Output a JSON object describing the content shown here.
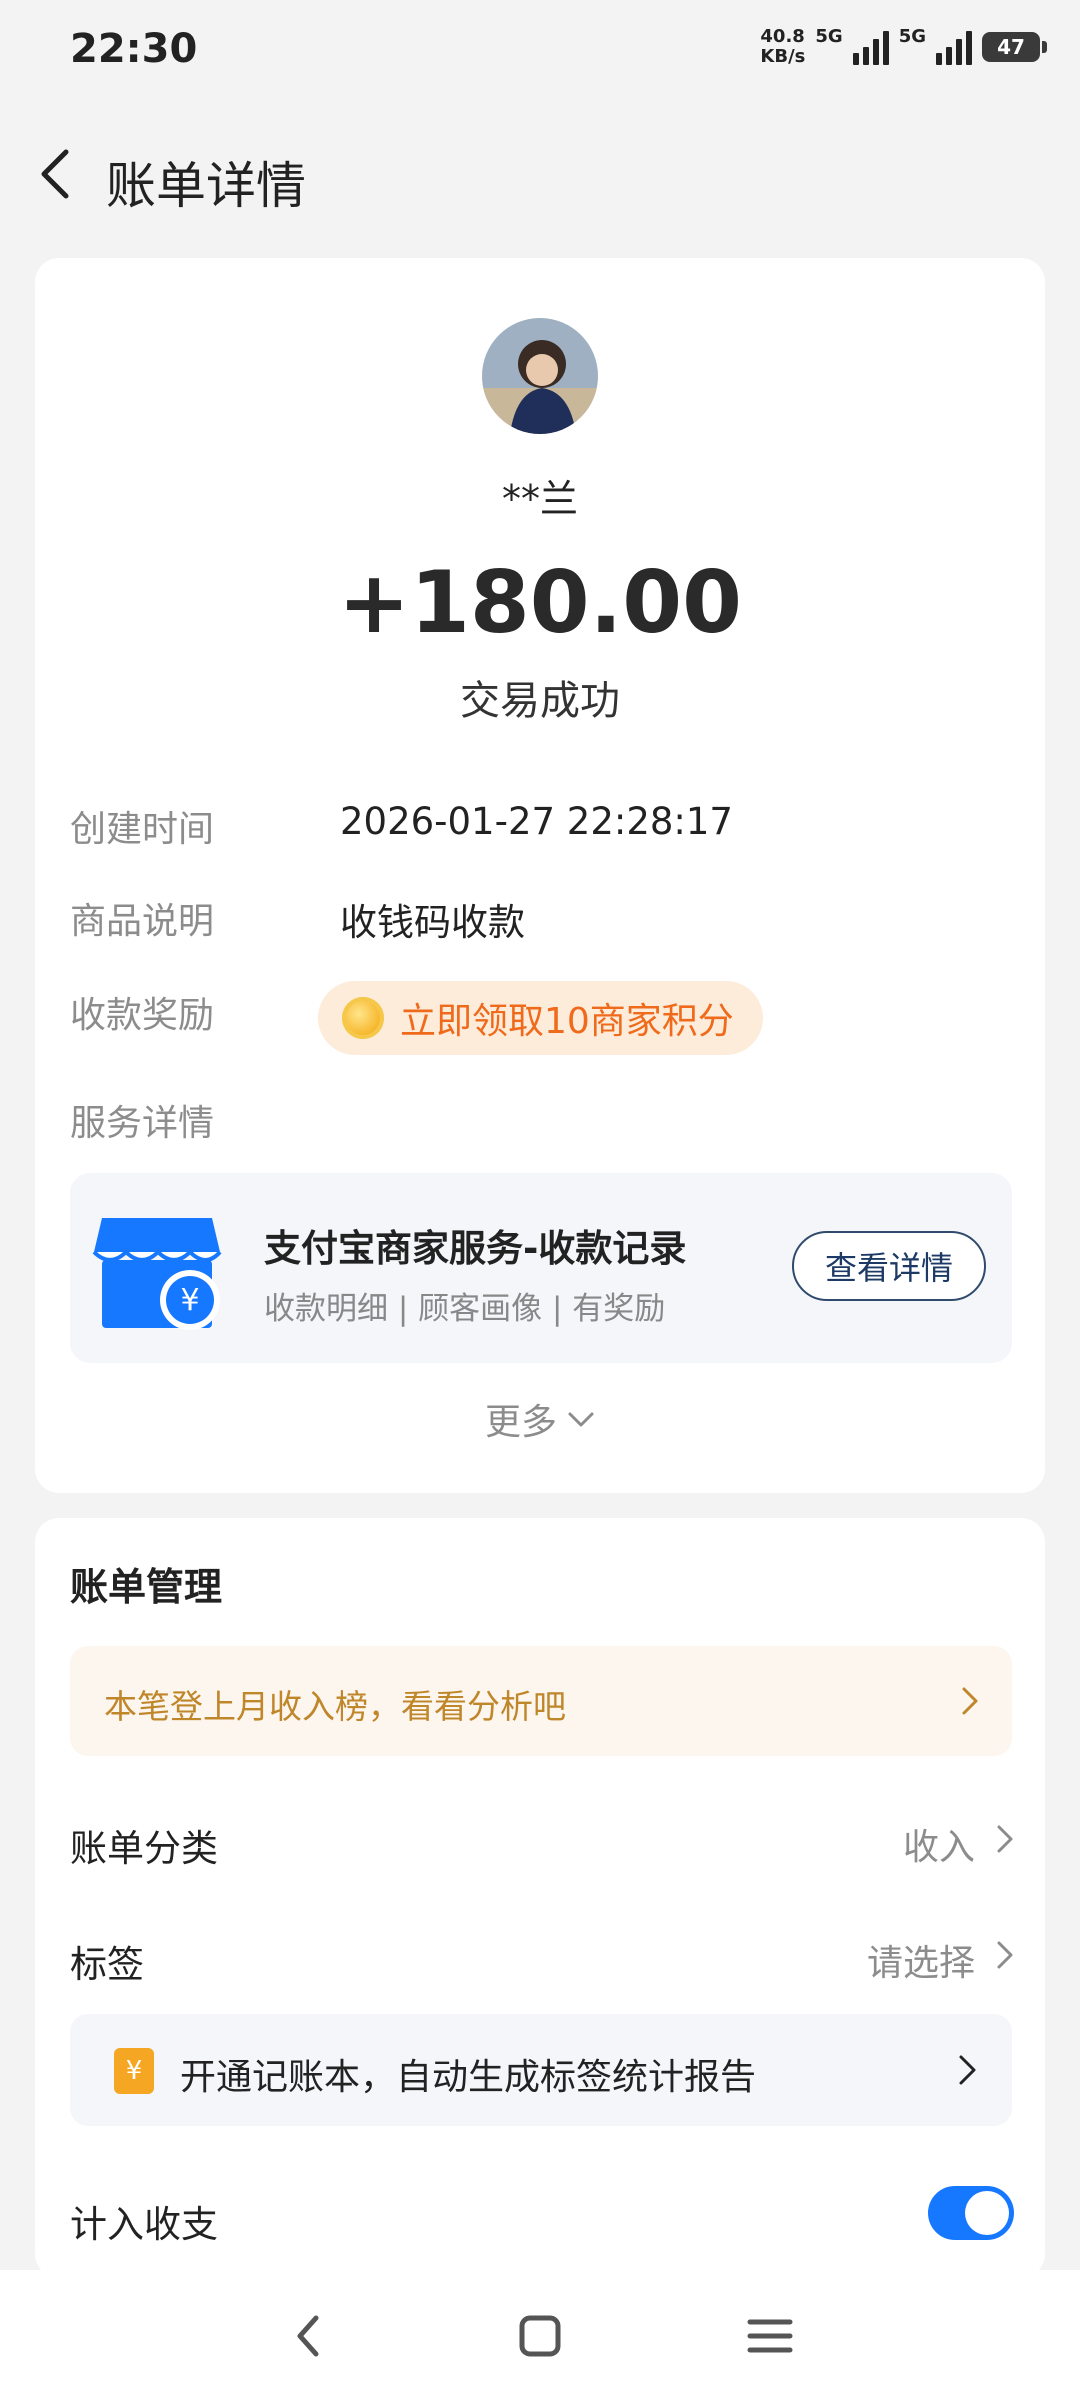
{
  "status_bar": {
    "time": "22:30",
    "speed_value": "40.8",
    "speed_unit": "KB/s",
    "net1": "5G",
    "net2": "5G",
    "battery": "47"
  },
  "header": {
    "title": "账单详情",
    "back_icon": "chevron-left-icon"
  },
  "transaction": {
    "payer_name": "**兰",
    "amount": "+180.00",
    "status": "交易成功"
  },
  "details": {
    "created_label": "创建时间",
    "created_value": "2026-01-27 22:28:17",
    "desc_label": "商品说明",
    "desc_value": "收钱码收款",
    "reward_label": "收款奖励",
    "reward_text": "立即领取10商家积分",
    "service_label": "服务详情"
  },
  "service": {
    "title": "支付宝商家服务-收款记录",
    "subtitle": "收款明细 | 顾客画像 | 有奖励",
    "button": "查看详情",
    "icon": "shop-yuan-icon"
  },
  "more": {
    "label": "更多"
  },
  "management": {
    "title": "账单管理",
    "banner": "本笔登上月收入榜，看看分析吧",
    "category_label": "账单分类",
    "category_value": "收入",
    "tag_label": "标签",
    "tag_value": "请选择",
    "promo_text": "开通记账本，自动生成标签统计报告",
    "include_label": "计入收支",
    "include_enabled": true
  },
  "colors": {
    "accent": "#1677ff",
    "reward": "#f06a1c",
    "banner_text": "#c0862a"
  }
}
